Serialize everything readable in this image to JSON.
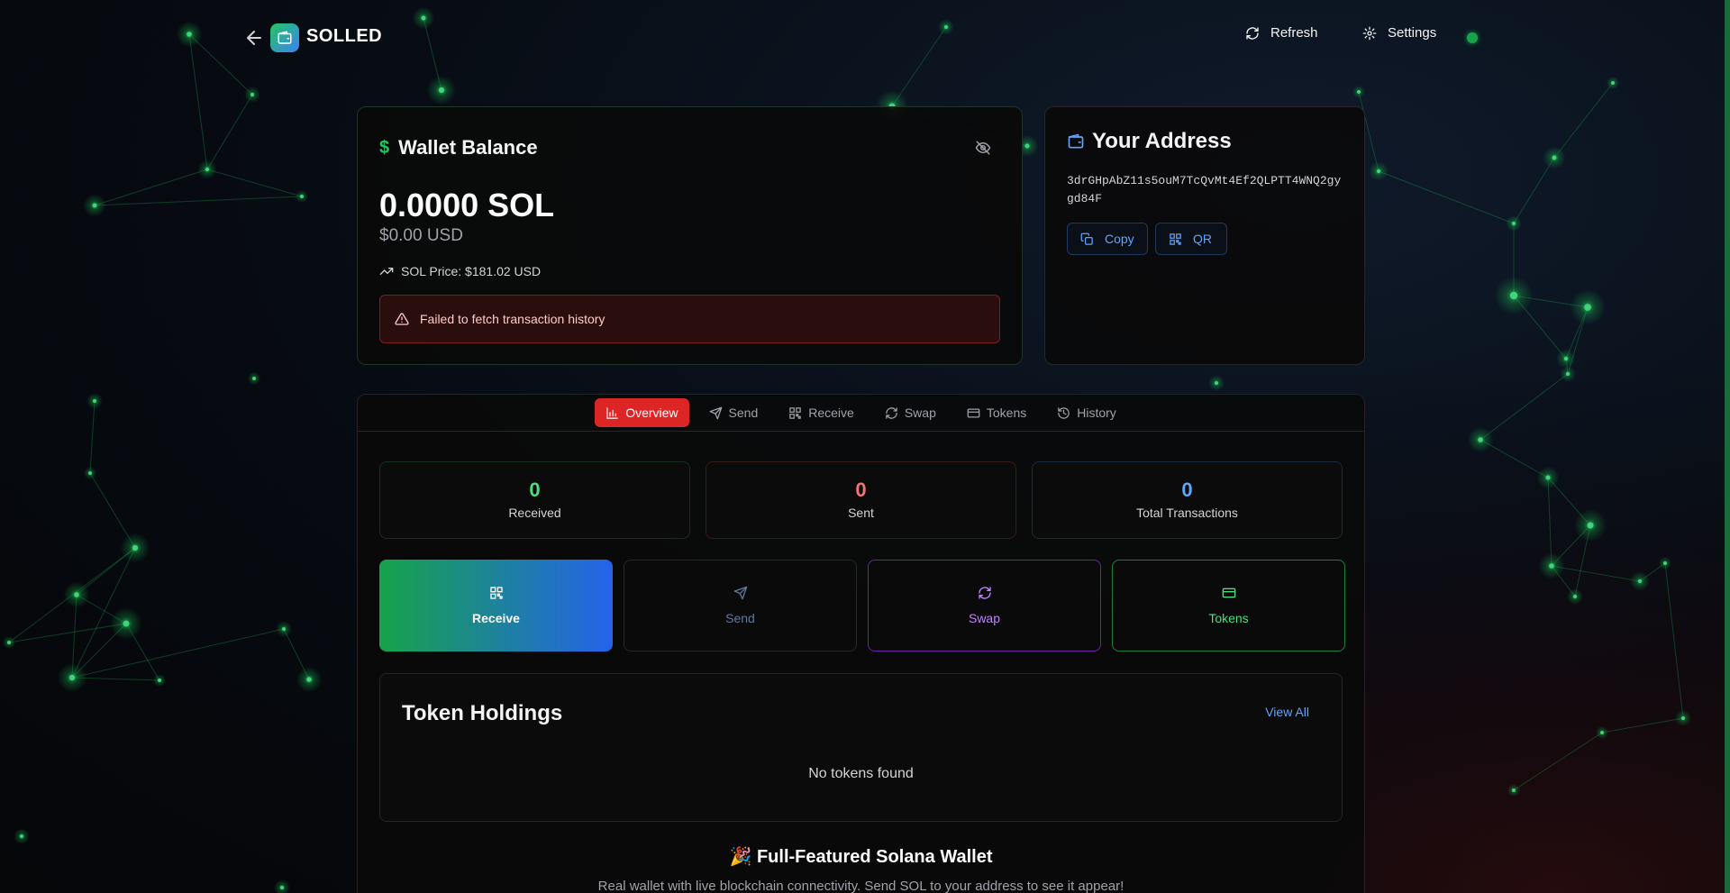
{
  "header": {
    "brand": "SOLLED",
    "refresh_label": "Refresh",
    "settings_label": "Settings"
  },
  "balance": {
    "title": "Wallet Balance",
    "sol_amount": "0.0000 SOL",
    "usd_amount": "$0.00 USD",
    "price_text": "SOL Price: $181.02 USD",
    "error_text": "Failed to fetch transaction history"
  },
  "address": {
    "title": "Your Address",
    "value": "3drGHpAbZ11s5ouM7TcQvMt4Ef2QLPTT4WNQ2gygd84F",
    "copy_label": "Copy",
    "qr_label": "QR"
  },
  "tabs": [
    {
      "label": "Overview",
      "icon": "bar-chart-icon",
      "active": true
    },
    {
      "label": "Send",
      "icon": "send-icon",
      "active": false
    },
    {
      "label": "Receive",
      "icon": "qr-icon",
      "active": false
    },
    {
      "label": "Swap",
      "icon": "swap-icon",
      "active": false
    },
    {
      "label": "Tokens",
      "icon": "wallet-card-icon",
      "active": false
    },
    {
      "label": "History",
      "icon": "history-icon",
      "active": false
    }
  ],
  "stats": {
    "received": {
      "value": "0",
      "label": "Received"
    },
    "sent": {
      "value": "0",
      "label": "Sent"
    },
    "total": {
      "value": "0",
      "label": "Total Transactions"
    }
  },
  "actions": {
    "receive": "Receive",
    "send": "Send",
    "swap": "Swap",
    "tokens": "Tokens"
  },
  "holdings": {
    "title": "Token Holdings",
    "view_all": "View All",
    "empty_text": "No tokens found"
  },
  "promo": {
    "title": "🎉 Full-Featured Solana Wallet",
    "text": "Real wallet with live blockchain connectivity. Send SOL to your address to see it appear!"
  },
  "colors": {
    "accent_green": "#22c55e",
    "accent_blue": "#3b82f6",
    "active_tab": "#dc2626",
    "sent_red": "#f87171",
    "swap_purple": "#c084fc"
  }
}
